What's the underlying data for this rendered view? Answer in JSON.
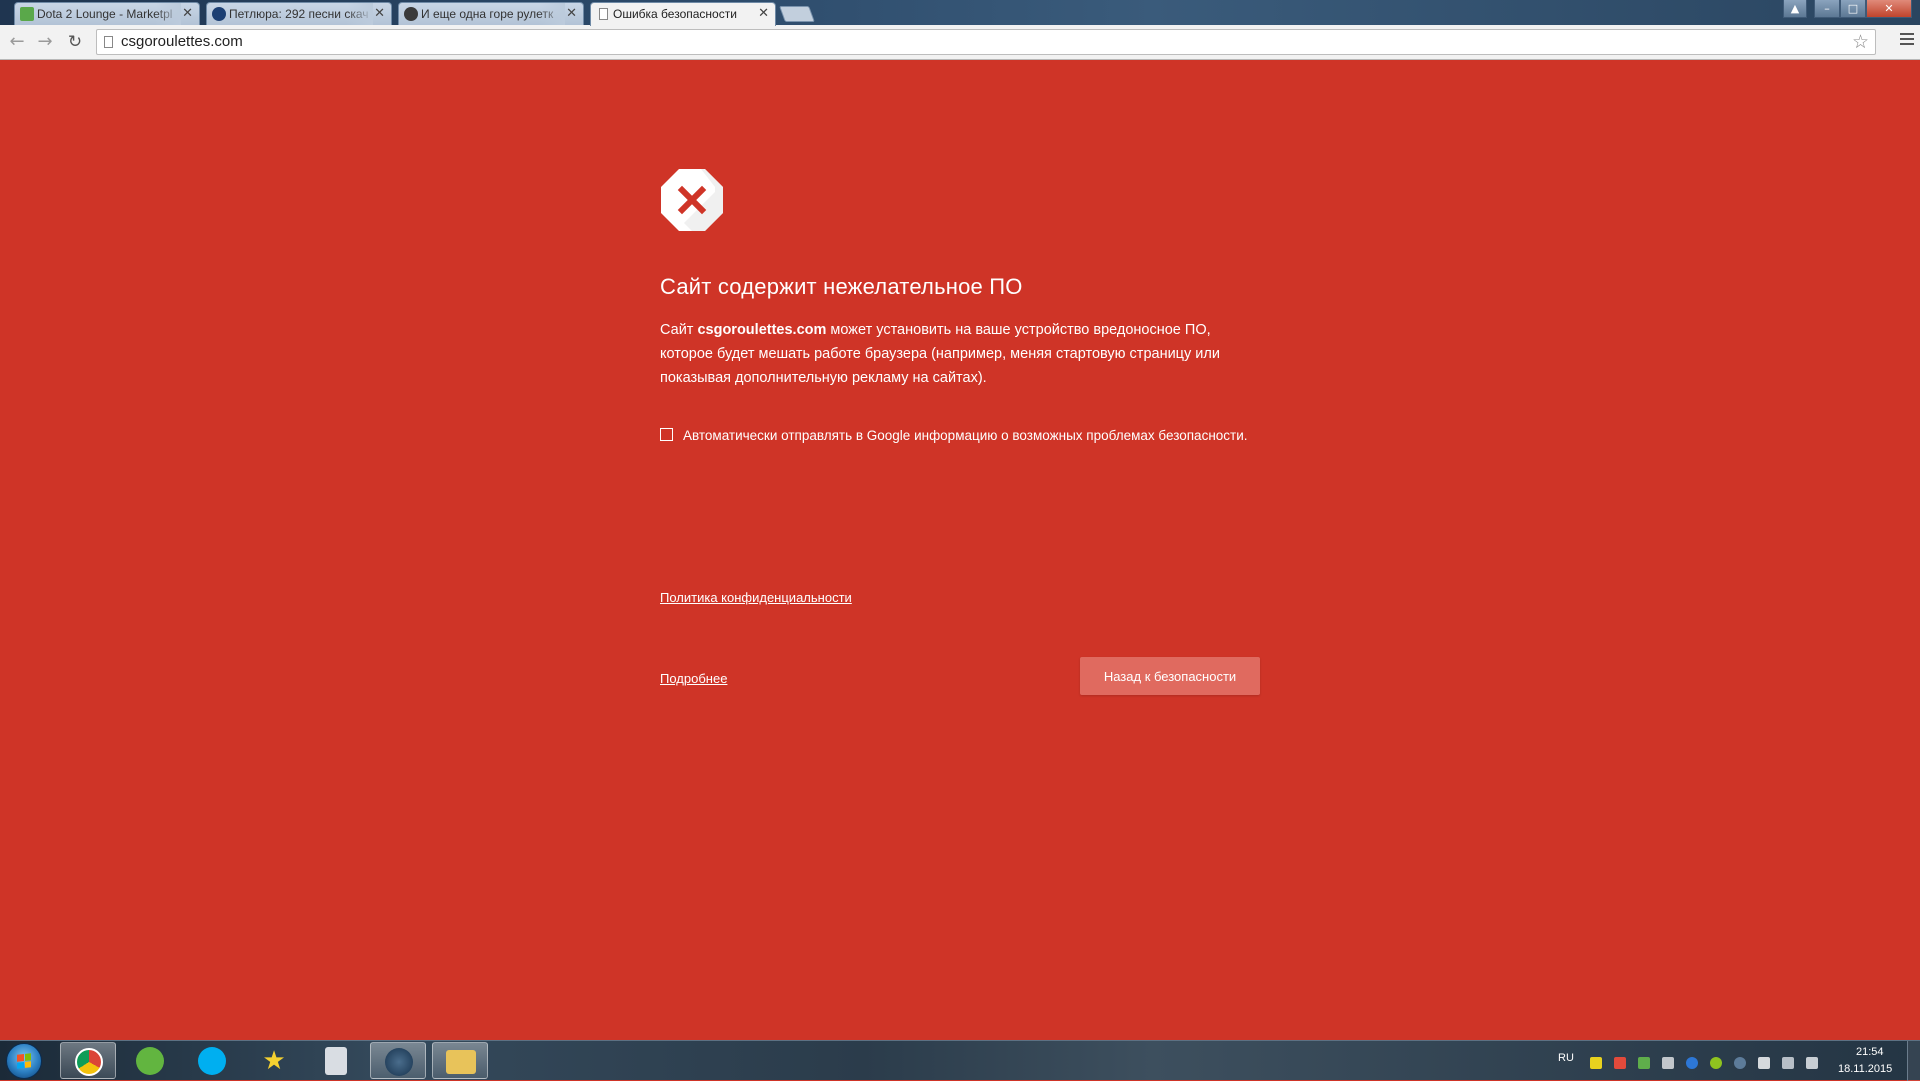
{
  "browser": {
    "tabs": [
      {
        "title": "Dota 2 Lounge - Marketpl",
        "favicon": "dota-lounge-icon",
        "active": false
      },
      {
        "title": "Петлюра: 292 песни скач",
        "favicon": "circle-icon",
        "active": false
      },
      {
        "title": "И еще одна горе рулетк",
        "favicon": "skull-icon",
        "active": false
      },
      {
        "title": "Ошибка безопасности",
        "favicon": "page-icon",
        "active": true
      }
    ],
    "close_glyph": "✕",
    "url": "csgoroulettes.com",
    "window_controls": {
      "minimize": "–",
      "maximize": "□",
      "close": "✕",
      "extra": "▲"
    }
  },
  "page": {
    "heading": "Сайт содержит нежелательное ПО",
    "explanation_prefix": "Сайт ",
    "explanation_domain": "csgoroulettes.com",
    "explanation_suffix": " может установить на ваше устройство вредоносное ПО, которое будет мешать работе браузера (например, меняя стартовую страницу или показывая дополнительную рекламу на сайтах).",
    "optin_label": "Автоматически отправлять в Google информацию о возможных проблемах безопасности.",
    "optin_checked": false,
    "privacy_link": "Политика конфиденциальности",
    "details_link": "Подробнее",
    "back_button": "Назад к безопасности",
    "icon": "warning-x-icon",
    "background_color": "#cf3427"
  },
  "taskbar": {
    "items": [
      {
        "name": "chrome-icon",
        "active": true
      },
      {
        "name": "utorrent-icon",
        "active": false
      },
      {
        "name": "skype-icon",
        "active": false
      },
      {
        "name": "star-icon",
        "active": false
      },
      {
        "name": "calculator-icon",
        "active": false
      },
      {
        "name": "steam-icon",
        "active": true
      },
      {
        "name": "explorer-folder-icon",
        "active": true
      }
    ],
    "language": "RU",
    "time": "21:54",
    "date": "18.11.2015"
  }
}
